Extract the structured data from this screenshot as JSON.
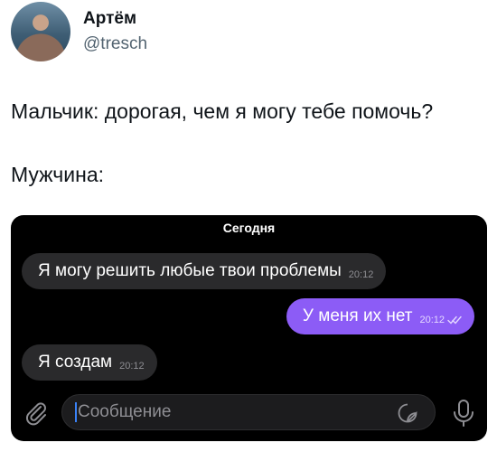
{
  "author": {
    "name": "Артём",
    "handle": "@tresch"
  },
  "tweet": {
    "line1": "Мальчик: дорогая, чем я могу тебе помочь?",
    "line2": "Мужчина:"
  },
  "chat": {
    "date_label": "Сегодня",
    "messages": [
      {
        "text": "Я могу решить любые твои проблемы",
        "time": "20:12",
        "direction": "incoming"
      },
      {
        "text": "У меня их нет",
        "time": "20:12",
        "direction": "outgoing",
        "status": "read"
      },
      {
        "text": "Я создам",
        "time": "20:12",
        "direction": "incoming"
      }
    ],
    "composer": {
      "placeholder": "Сообщение",
      "attach_icon": "paperclip-icon",
      "sticker_icon": "sticker-icon",
      "mic_icon": "microphone-icon"
    },
    "colors": {
      "background": "#000000",
      "incoming_bubble": "#2a2a2c",
      "outgoing_bubble": "#8c5cf6"
    }
  }
}
